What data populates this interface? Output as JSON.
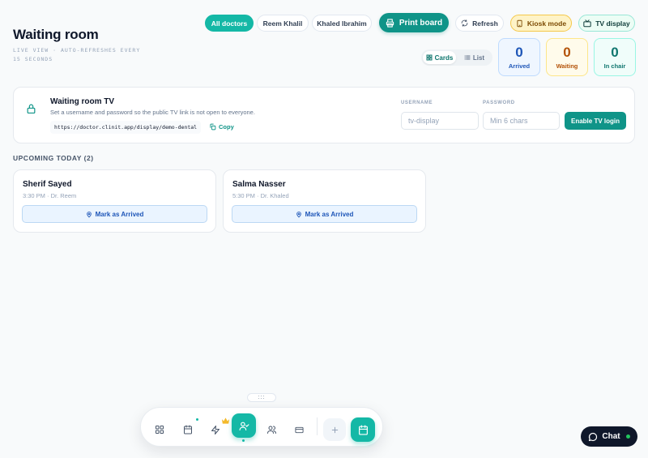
{
  "header": {
    "title": "Waiting room",
    "subtitle": "LIVE VIEW · AUTO-REFRESHES EVERY 15 SECONDS"
  },
  "doctor_filters": [
    {
      "label": "All doctors",
      "active": true
    },
    {
      "label": "Reem Khalil",
      "active": false
    },
    {
      "label": "Khaled Ibrahim",
      "active": false
    }
  ],
  "actions": {
    "print": "Print board",
    "refresh": "Refresh",
    "kiosk": "Kiosk mode",
    "tv_display": "TV display"
  },
  "view_toggle": {
    "cards": "Cards",
    "list": "List",
    "selected": "Cards"
  },
  "stats": {
    "arrived": {
      "value": "0",
      "label": "Arrived"
    },
    "waiting": {
      "value": "0",
      "label": "Waiting"
    },
    "in_chair": {
      "value": "0",
      "label": "In chair"
    }
  },
  "tv": {
    "title": "Waiting room TV",
    "description": "Set a username and password so the public TV link is not open to everyone.",
    "url": "https://doctor.clinit.app/display/demo-dental",
    "copy": "Copy",
    "username_label": "USERNAME",
    "username_placeholder": "tv-display",
    "password_label": "PASSWORD",
    "password_placeholder": "Min 6 chars",
    "enable": "Enable TV login"
  },
  "upcoming": {
    "heading": "UPCOMING TODAY (2)",
    "appointments": [
      {
        "name": "Sherif Sayed",
        "meta": "3:30 PM · Dr. Reem",
        "action": "Mark as Arrived"
      },
      {
        "name": "Salma Nasser",
        "meta": "5:30 PM · Dr. Khaled",
        "action": "Mark as Arrived"
      }
    ]
  },
  "dock": {
    "grip": ":::",
    "items": [
      "grid-icon",
      "calendar-icon",
      "bolt-icon",
      "user-check-icon",
      "users-icon",
      "card-icon",
      "plus-icon",
      "calendar-icon"
    ],
    "active": "user-check-icon"
  },
  "chat": {
    "label": "Chat"
  },
  "colors": {
    "accent": "#14b8a6",
    "accent_dark": "#0f9488",
    "arrived": "#1e56b8",
    "waiting": "#b45309",
    "in_chair": "#0f766e"
  }
}
